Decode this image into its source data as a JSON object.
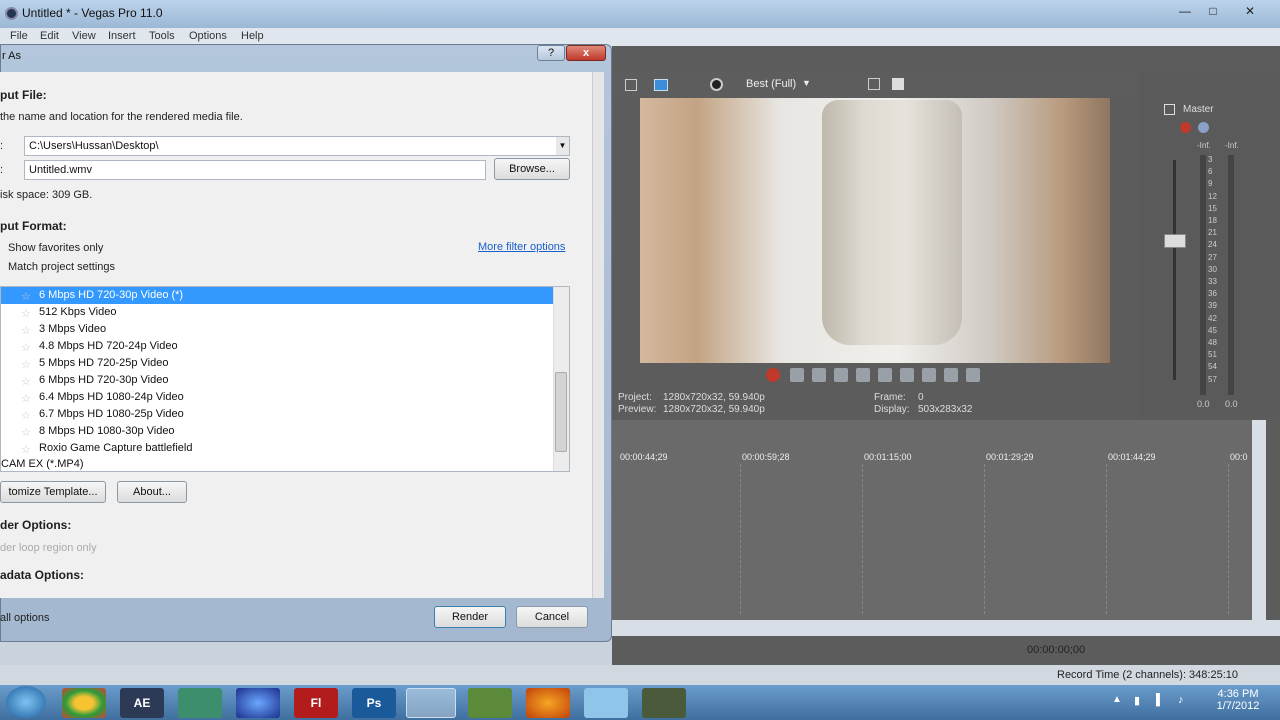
{
  "app": {
    "title": "Untitled * - Vegas Pro 11.0",
    "menu": [
      "File",
      "Edit",
      "View",
      "Insert",
      "Tools",
      "Options",
      "Help"
    ]
  },
  "preview": {
    "quality": "Best (Full)",
    "project_label": "Project:",
    "project_value": "1280x720x32, 59.940p",
    "preview_label": "Preview:",
    "preview_value": "1280x720x32, 59.940p",
    "frame_label": "Frame:",
    "frame_value": "0",
    "display_label": "Display:",
    "display_value": "503x283x32"
  },
  "mixer": {
    "title": "Master",
    "inf_l": "-Inf.",
    "inf_r": "-Inf.",
    "scale": [
      "3",
      "6",
      "9",
      "12",
      "15",
      "18",
      "21",
      "24",
      "27",
      "30",
      "33",
      "36",
      "39",
      "42",
      "45",
      "48",
      "51",
      "54",
      "57"
    ],
    "val_l": "0.0",
    "val_r": "0.0"
  },
  "timeline": {
    "ticks": [
      "00:00:44;29",
      "00:00:59;28",
      "00:01:15;00",
      "00:01:29;29",
      "00:01:44;29",
      "00:0"
    ],
    "timecode": "00:00:00;00",
    "record_time": "Record Time (2 channels): 348:25:10"
  },
  "dialog": {
    "title": "r As",
    "output_file_heading": "put File:",
    "output_file_desc": "the name and location for the rendered media file.",
    "folder_label": ":",
    "folder_value": "C:\\Users\\Hussan\\Desktop\\",
    "name_label": ":",
    "name_value": "Untitled.wmv",
    "browse": "Browse...",
    "disk_space": "isk space: 309 GB.",
    "output_format_heading": "put Format:",
    "show_favorites": "Show favorites only",
    "match_project": "Match project settings",
    "more_filter": "More filter options",
    "templates": [
      "6 Mbps HD 720-30p Video (*)",
      "512 Kbps Video",
      "3 Mbps Video",
      "4.8 Mbps HD 720-24p Video",
      "5 Mbps HD 720-25p Video",
      "6 Mbps HD 720-30p Video",
      "6.4 Mbps HD 1080-24p Video",
      "6.7 Mbps HD 1080-25p Video",
      "8 Mbps HD 1080-30p Video",
      "Roxio Game Capture battlefield"
    ],
    "group_label": "CAM EX (*.MP4)",
    "customize": "tomize Template...",
    "about": "About...",
    "render_options_heading": "der Options:",
    "render_loop": "der loop region only",
    "metadata_heading": "adata Options:",
    "all_options": "all options",
    "render": "Render",
    "cancel": "Cancel",
    "help": "?",
    "close": "x"
  },
  "taskbar": {
    "apps": [
      "AE",
      "Fl",
      "Ps"
    ],
    "time": "4:36 PM",
    "date": "1/7/2012"
  }
}
